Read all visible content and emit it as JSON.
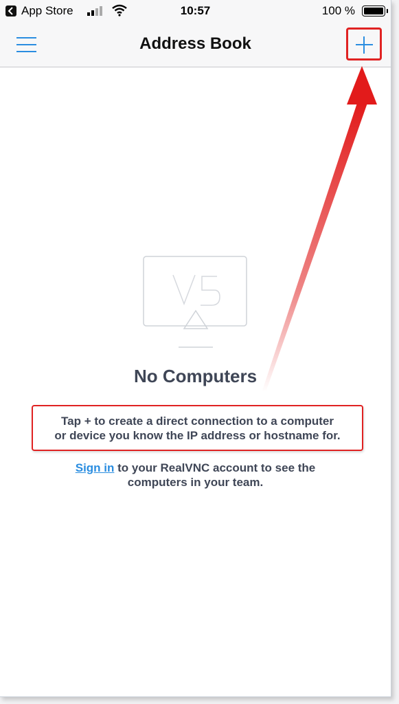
{
  "status_bar": {
    "back_app": "App Store",
    "time": "10:57",
    "battery": "100 %"
  },
  "navbar": {
    "title": "Address Book",
    "menu_icon": "hamburger-menu-icon",
    "add_icon": "plus-icon"
  },
  "empty_state": {
    "logo_icon": "vnc-monitor-icon",
    "title": "No Computers",
    "hint_line1": "Tap + to create a direct connection to a computer",
    "hint_line2": "or device you know the IP address or hostname for.",
    "signin_link": "Sign in",
    "signin_rest_line1": " to your RealVNC account to see the",
    "signin_line2": "computers in your team."
  },
  "colors": {
    "accent": "#2a8de0",
    "annotation": "#e02222",
    "text": "#3f4656"
  }
}
